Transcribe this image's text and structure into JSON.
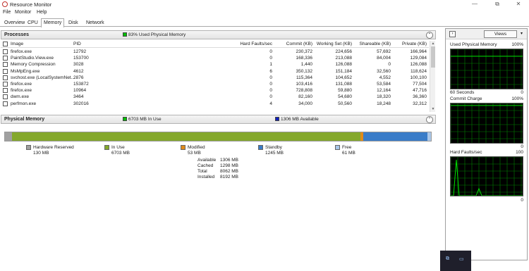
{
  "window": {
    "title": "Resource Monitor",
    "minimize_glyph": "—",
    "restore_glyph": "⧉",
    "close_glyph": "✕"
  },
  "menu": {
    "file": "File",
    "monitor": "Monitor",
    "help": "Help"
  },
  "tabs": [
    {
      "label": "Overview"
    },
    {
      "label": "CPU"
    },
    {
      "label": "Memory",
      "active": true
    },
    {
      "label": "Disk"
    },
    {
      "label": "Network"
    }
  ],
  "processes": {
    "title": "Processes",
    "status": "83% Used Physical Memory",
    "status_color": "#00c000",
    "columns": {
      "image": "Image",
      "pid": "PID",
      "hard_faults": "Hard Faults/sec",
      "commit": "Commit (KB)",
      "working_set": "Working Set (KB)",
      "shareable": "Shareable (KB)",
      "private": "Private (KB)"
    },
    "rows": [
      {
        "image": "firefox.exe",
        "pid": "12792",
        "hard_faults": "0",
        "commit": "230,372",
        "working_set": "224,656",
        "shareable": "57,692",
        "private": "166,964"
      },
      {
        "image": "PaintStudio.View.exe",
        "pid": "153700",
        "hard_faults": "0",
        "commit": "168,336",
        "working_set": "213,088",
        "shareable": "84,004",
        "private": "129,084"
      },
      {
        "image": "Memory Compression",
        "pid": "3028",
        "hard_faults": "1",
        "commit": "1,440",
        "working_set": "126,088",
        "shareable": "0",
        "private": "126,088"
      },
      {
        "image": "MsMpEng.exe",
        "pid": "4612",
        "hard_faults": "6",
        "commit": "350,132",
        "working_set": "151,184",
        "shareable": "32,560",
        "private": "118,624"
      },
      {
        "image": "svchost.exe (LocalSystemNet...",
        "pid": "2876",
        "hard_faults": "0",
        "commit": "115,364",
        "working_set": "104,652",
        "shareable": "4,552",
        "private": "100,100"
      },
      {
        "image": "firefox.exe",
        "pid": "153872",
        "hard_faults": "0",
        "commit": "103,416",
        "working_set": "131,088",
        "shareable": "53,584",
        "private": "77,504"
      },
      {
        "image": "firefox.exe",
        "pid": "10964",
        "hard_faults": "0",
        "commit": "728,808",
        "working_set": "59,880",
        "shareable": "12,164",
        "private": "47,716"
      },
      {
        "image": "dwm.exe",
        "pid": "3464",
        "hard_faults": "0",
        "commit": "82,160",
        "working_set": "54,680",
        "shareable": "18,320",
        "private": "36,360"
      },
      {
        "image": "perfmon.exe",
        "pid": "302016",
        "hard_faults": "4",
        "commit": "34,000",
        "working_set": "50,560",
        "shareable": "18,248",
        "private": "32,312"
      }
    ]
  },
  "physical_memory": {
    "title": "Physical Memory",
    "in_use_status": "6703 MB In Use",
    "available_status": "1306 MB Available",
    "in_use_color": "#00c000",
    "available_color": "#1020c0",
    "legend": [
      {
        "name": "Hardware Reserved",
        "value": "130 MB",
        "color": "#a0a0a0",
        "mb": 130
      },
      {
        "name": "In Use",
        "value": "6703 MB",
        "color": "#84a82c",
        "mb": 6703
      },
      {
        "name": "Modified",
        "value": "53 MB",
        "color": "#e08a1a",
        "mb": 53
      },
      {
        "name": "Standby",
        "value": "1245 MB",
        "color": "#3a7cc8",
        "mb": 1245
      },
      {
        "name": "Free",
        "value": "61 MB",
        "color": "#a9c6e8",
        "mb": 61
      }
    ],
    "summary": [
      {
        "label": "Available",
        "value": "1306 MB"
      },
      {
        "label": "Cached",
        "value": "1298 MB"
      },
      {
        "label": "Total",
        "value": "8062 MB"
      },
      {
        "label": "Installed",
        "value": "8192 MB"
      }
    ]
  },
  "side_panel": {
    "views_label": "Views",
    "graphs": [
      {
        "title": "Used Physical Memory",
        "max": "100%",
        "footer": "60 Seconds",
        "footer_right": "0",
        "level": 0.83
      },
      {
        "title": "Commit Charge",
        "max": "100%",
        "footer": "",
        "footer_right": "0",
        "level": 0.95
      },
      {
        "title": "Hard Faults/sec",
        "max": "100",
        "footer": "",
        "footer_right": "0",
        "level": 0.02
      }
    ],
    "graph_line_color": "#00e000",
    "graph_grid_color": "#008000"
  },
  "taskbar": {
    "icon_a": "⧉",
    "icon_b": "▭"
  }
}
